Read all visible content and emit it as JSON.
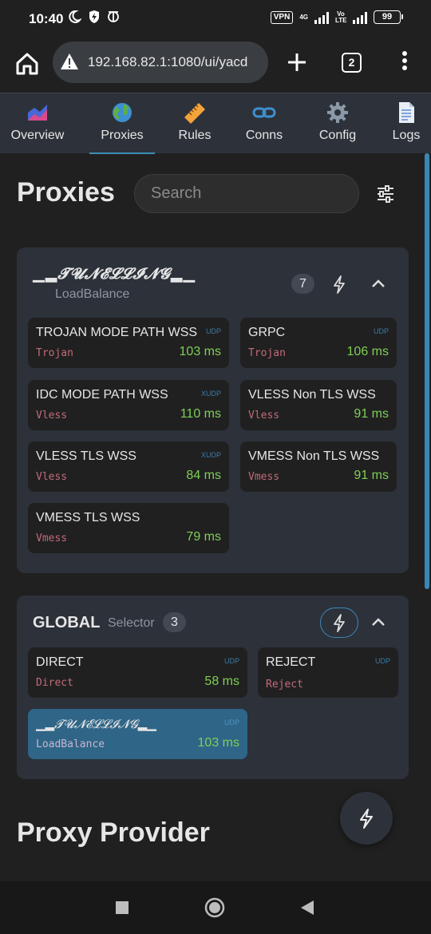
{
  "status_bar": {
    "time": "10:40",
    "vpn_label": "VPN",
    "net_4g": "4G",
    "net_volte": "Vo LTE",
    "battery": "99"
  },
  "browser": {
    "url": "192.168.82.1:1080/ui/yacd",
    "tab_count": "2"
  },
  "nav": {
    "tabs": [
      {
        "label": "Overview",
        "icon": "chart-icon"
      },
      {
        "label": "Proxies",
        "icon": "globe-icon"
      },
      {
        "label": "Rules",
        "icon": "ruler-icon"
      },
      {
        "label": "Conns",
        "icon": "link-icon"
      },
      {
        "label": "Config",
        "icon": "gear-icon"
      },
      {
        "label": "Logs",
        "icon": "document-icon"
      }
    ],
    "active": "Proxies"
  },
  "page": {
    "title": "Proxies",
    "search_placeholder": "Search"
  },
  "groups": [
    {
      "name": "▁▂𝓣𝓤𝓝𝓔𝓛𝓛𝓘𝓝𝓖▂▁",
      "type": "LoadBalance",
      "count": "7",
      "proxies": [
        {
          "name": "TROJAN MODE PATH WSS",
          "tag": "UDP",
          "type": "Trojan",
          "latency": "103 ms"
        },
        {
          "name": "GRPC",
          "tag": "UDP",
          "type": "Trojan",
          "latency": "106 ms"
        },
        {
          "name": "IDC MODE PATH WSS",
          "tag": "XUDP",
          "type": "Vless",
          "latency": "110 ms"
        },
        {
          "name": "VLESS Non TLS WSS",
          "tag": "",
          "type": "Vless",
          "latency": "91 ms"
        },
        {
          "name": "VLESS TLS WSS",
          "tag": "XUDP",
          "type": "Vless",
          "latency": "84 ms"
        },
        {
          "name": "VMESS Non TLS WSS",
          "tag": "",
          "type": "Vmess",
          "latency": "91 ms"
        },
        {
          "name": "VMESS TLS WSS",
          "tag": "",
          "type": "Vmess",
          "latency": "79 ms"
        }
      ]
    },
    {
      "name": "GLOBAL",
      "type": "Selector",
      "count": "3",
      "proxies": [
        {
          "name": "DIRECT",
          "tag": "UDP",
          "type": "Direct",
          "latency": "58 ms"
        },
        {
          "name": "REJECT",
          "tag": "UDP",
          "type": "Reject",
          "latency": ""
        },
        {
          "name": "▁▂𝓣𝓤𝓝𝓔𝓛𝓛𝓘𝓝𝓖▂▁",
          "tag": "UDP",
          "type": "LoadBalance",
          "latency": "103 ms",
          "selected": true
        }
      ]
    }
  ],
  "section2_title": "Proxy Provider",
  "colors": {
    "bg": "#202020",
    "panel": "#2c313a",
    "accent": "#3c8fb5",
    "latency_good": "#7fcf56",
    "type_text": "#c26b7a",
    "selected": "#2f6587"
  }
}
